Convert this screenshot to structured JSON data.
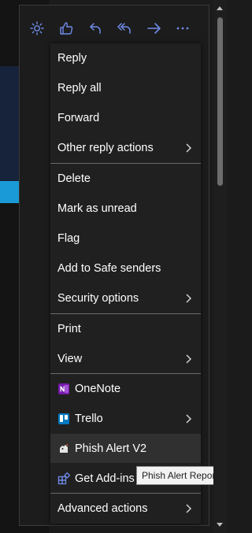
{
  "toolbar": {
    "icons": [
      "sun-icon",
      "thumbs-up-icon",
      "reply-icon",
      "reply-all-icon",
      "forward-icon",
      "more-icon"
    ],
    "accent": "#6f8be9"
  },
  "menu": {
    "reply": "Reply",
    "reply_all": "Reply all",
    "forward": "Forward",
    "other_reply_actions": "Other reply actions",
    "delete": "Delete",
    "mark_as_unread": "Mark as unread",
    "flag": "Flag",
    "add_to_safe_senders": "Add to Safe senders",
    "security_options": "Security options",
    "print": "Print",
    "view": "View",
    "onenote": "OneNote",
    "trello": "Trello",
    "phish_alert": "Phish Alert V2",
    "get_addins": "Get Add-ins",
    "advanced_actions": "Advanced actions"
  },
  "tooltip": {
    "text": "Phish Alert Report"
  },
  "colors": {
    "menu_bg": "#202020",
    "hover_bg": "#303030",
    "separator": "#6a6a6a",
    "onenote": "#7719aa",
    "trello": "#0079bf",
    "addins": "#6f8be9"
  }
}
